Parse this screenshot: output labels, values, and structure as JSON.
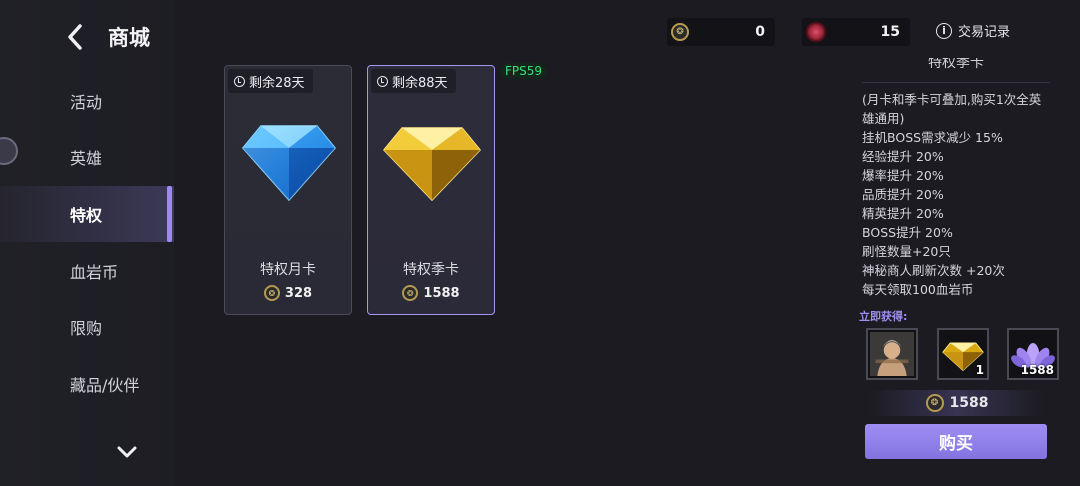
{
  "sidebar": {
    "title": "商城",
    "items": [
      {
        "label": "活动"
      },
      {
        "label": "英雄"
      },
      {
        "label": "特权"
      },
      {
        "label": "血岩币"
      },
      {
        "label": "限购"
      },
      {
        "label": "藏品/伙伴"
      }
    ],
    "active_index": 2
  },
  "currencies": [
    {
      "icon": "gold-coin-icon",
      "value": "0"
    },
    {
      "icon": "blood-rock-coin-icon",
      "value": "15"
    }
  ],
  "trade_log_label": "交易记录",
  "fps_label": "FPS59",
  "cards": [
    {
      "timer": "剩余28天",
      "name": "特权月卡",
      "price": "328",
      "gem": "blue-diamond-icon"
    },
    {
      "timer": "剩余88天",
      "name": "特权季卡",
      "price": "1588",
      "gem": "gold-diamond-icon"
    }
  ],
  "selected_card_index": 1,
  "detail": {
    "title": "特权季卡",
    "lines": [
      "(月卡和季卡可叠加,购买1次全英",
      "雄通用)",
      "挂机BOSS需求减少 15%",
      "经验提升 20%",
      "爆率提升 20%",
      "品质提升 20%",
      "精英提升 20%",
      "BOSS提升 20%",
      "刷怪数量+20只",
      "神秘商人刷新次数 +20次",
      "每天领取100血岩币"
    ],
    "obtain_label": "立即获得:",
    "rewards": [
      {
        "icon": "hero-portrait-icon",
        "count": ""
      },
      {
        "icon": "gold-diamond-icon",
        "count": "1"
      },
      {
        "icon": "purple-lotus-icon",
        "count": "1588"
      }
    ],
    "price": "1588",
    "buy_label": "购买"
  },
  "colors": {
    "accent": "#9e8ef3",
    "background": "#1b1b21",
    "fps": "#38e07a"
  }
}
